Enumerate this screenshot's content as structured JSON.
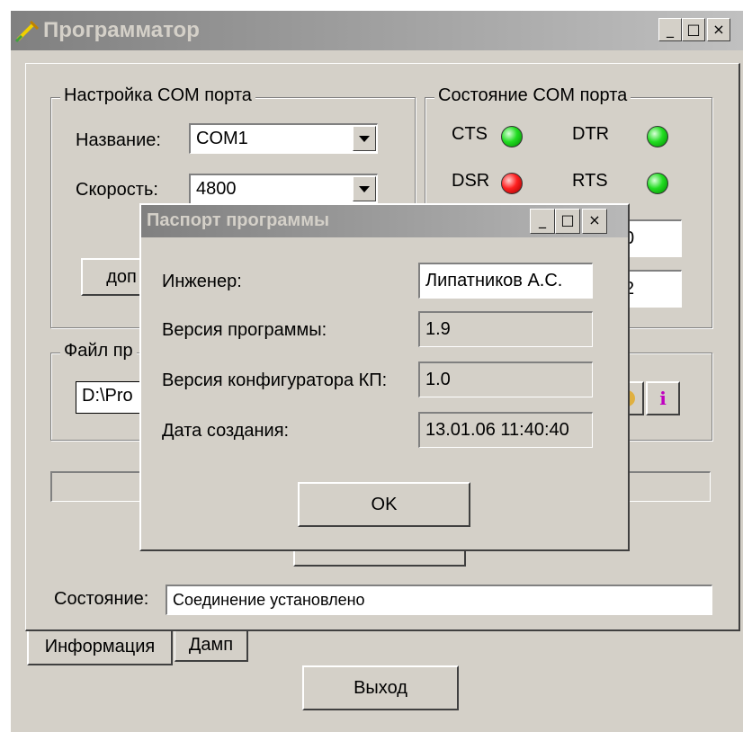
{
  "window": {
    "title": "Программатор",
    "minimize_glyph": "_",
    "maximize_glyph": "□",
    "close_glyph": "×"
  },
  "com_settings": {
    "group_label": "Настройка COM порта",
    "name_label": "Название:",
    "name_value": "COM1",
    "speed_label": "Скорость:",
    "speed_value": "4800",
    "extra_button_label": "доп"
  },
  "com_state": {
    "group_label": "Состояние COM порта",
    "signals": [
      {
        "label": "CTS",
        "state": "green"
      },
      {
        "label": "DTR",
        "state": "green"
      },
      {
        "label": "DSR",
        "state": "red"
      },
      {
        "label": "RTS",
        "state": "green"
      }
    ],
    "field1_value": "0",
    "field2_value": "2"
  },
  "file": {
    "group_label": "Файл пр",
    "path_value": "D:\\Pro",
    "info_icon_glyph": "i"
  },
  "status": {
    "label": "Состояние:",
    "value": "Соединение установлено"
  },
  "tabs": [
    {
      "label": "Информация",
      "active": true
    },
    {
      "label": "Дамп",
      "active": false
    }
  ],
  "exit_button_label": "Выход",
  "dialog": {
    "title": "Паспорт программы",
    "rows": [
      {
        "label": "Инженер:",
        "value": "Липатников А.С."
      },
      {
        "label": "Версия программы:",
        "value": "1.9"
      },
      {
        "label": "Версия конфигуратора КП:",
        "value": "1.0"
      },
      {
        "label": "Дата создания:",
        "value": "13.01.06 11:40:40"
      }
    ],
    "ok_label": "OK"
  },
  "colors": {
    "face": "#d4d0c8",
    "led_green": "#22dd22",
    "led_red": "#ff2020",
    "title_gradient_start": "#808080"
  }
}
